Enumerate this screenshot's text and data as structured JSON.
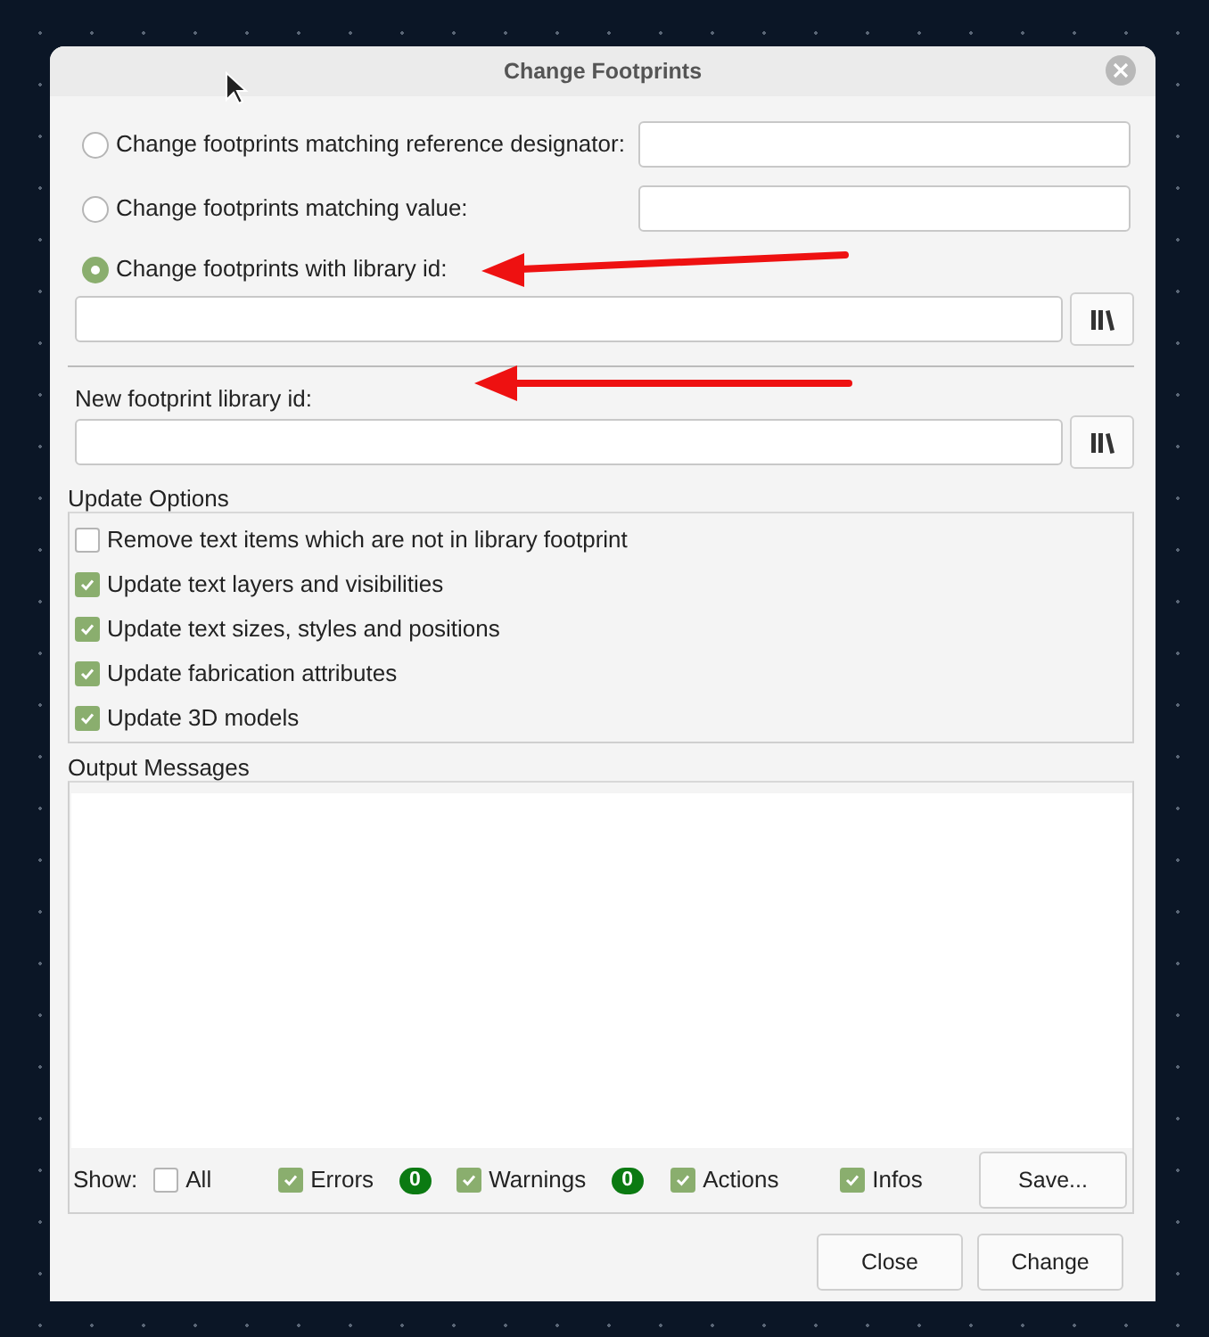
{
  "window": {
    "title": "Change Footprints"
  },
  "match_options": [
    {
      "label": "Change footprints matching reference designator:",
      "selected": false,
      "kind": "inline"
    },
    {
      "label": "Change footprints matching value:",
      "selected": false,
      "kind": "inline"
    },
    {
      "label": "Change footprints with library id:",
      "selected": true,
      "kind": "below"
    }
  ],
  "new_footprint": {
    "label": "New footprint library id:"
  },
  "update_options": {
    "title": "Update Options",
    "items": [
      {
        "label": "Remove text items which are not in library footprint",
        "checked": false
      },
      {
        "label": "Update text layers and visibilities",
        "checked": true
      },
      {
        "label": "Update text sizes, styles and positions",
        "checked": true
      },
      {
        "label": "Update fabrication attributes",
        "checked": true
      },
      {
        "label": "Update 3D models",
        "checked": true
      }
    ]
  },
  "output_messages": {
    "title": "Output Messages",
    "show_label": "Show:",
    "filters": [
      {
        "label": "All",
        "checked": false
      },
      {
        "label": "Errors",
        "checked": true,
        "count": "0"
      },
      {
        "label": "Warnings",
        "checked": true,
        "count": "0"
      },
      {
        "label": "Actions",
        "checked": true
      },
      {
        "label": "Infos",
        "checked": true
      }
    ],
    "save_button": "Save..."
  },
  "buttons": [
    "Close",
    "Change"
  ]
}
